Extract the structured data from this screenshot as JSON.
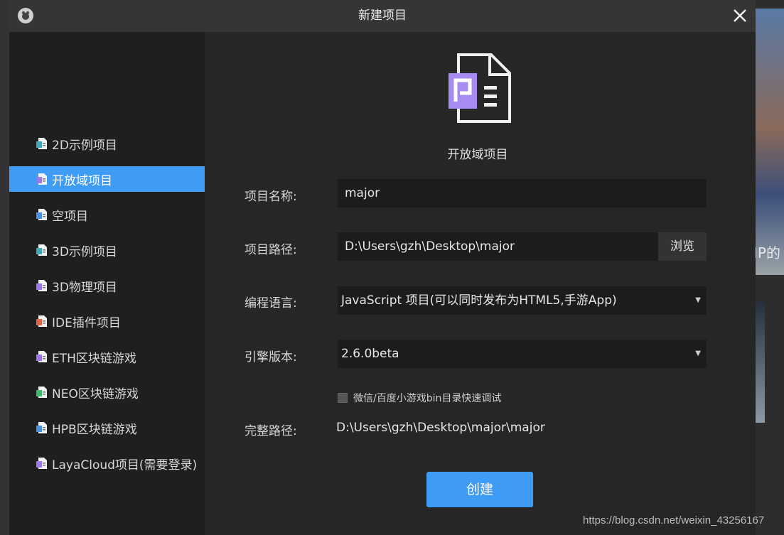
{
  "window": {
    "title": "新建项目"
  },
  "sidebar": {
    "items": [
      {
        "label": "2D示例项目",
        "icon": "file-teal-icon",
        "color": "#3fa7b5",
        "active": false
      },
      {
        "label": "开放域项目",
        "icon": "file-purple-icon",
        "color": "#9c78e8",
        "active": true
      },
      {
        "label": "空项目",
        "icon": "file-blue-icon",
        "color": "#4a90e2",
        "active": false
      },
      {
        "label": "3D示例项目",
        "icon": "file-teal-icon",
        "color": "#3fa7b5",
        "active": false
      },
      {
        "label": "3D物理项目",
        "icon": "file-purple-icon",
        "color": "#9c78e8",
        "active": false
      },
      {
        "label": "IDE插件项目",
        "icon": "file-red-icon",
        "color": "#e0664a",
        "active": false
      },
      {
        "label": "ETH区块链游戏",
        "icon": "file-purple-icon",
        "color": "#9c78e8",
        "active": false
      },
      {
        "label": "NEO区块链游戏",
        "icon": "file-green-icon",
        "color": "#3cba6a",
        "active": false
      },
      {
        "label": "HPB区块链游戏",
        "icon": "file-blue-icon",
        "color": "#4a90e2",
        "active": false
      },
      {
        "label": "LayaCloud项目(需要登录)",
        "icon": "file-purple-icon",
        "color": "#9c78e8",
        "active": false
      }
    ]
  },
  "main": {
    "project_type": "开放域项目",
    "icon_color": "#a78bf0",
    "name_label": "项目名称:",
    "name_value": "major",
    "path_label": "项目路径:",
    "path_value": "D:\\Users\\gzh\\Desktop\\major",
    "browse_label": "浏览",
    "language_label": "编程语言:",
    "language_value": "JavaScript 项目(可以同时发布为HTML5,手游App)",
    "engine_label": "引擎版本:",
    "engine_value": "2.6.0beta",
    "checkbox_label": "微信/百度小游戏bin目录快速调试",
    "checkbox_checked": false,
    "fullpath_label": "完整路径:",
    "fullpath_value": "D:\\Users\\gzh\\Desktop\\major\\major",
    "create_label": "创建"
  },
  "background": {
    "partial_text": "IP的"
  },
  "watermark": "https://blog.csdn.net/weixin_43256167",
  "colors": {
    "accent": "#3f9cf5",
    "dialog_bg": "#252525",
    "sidebar_bg": "#1f1f1f"
  }
}
